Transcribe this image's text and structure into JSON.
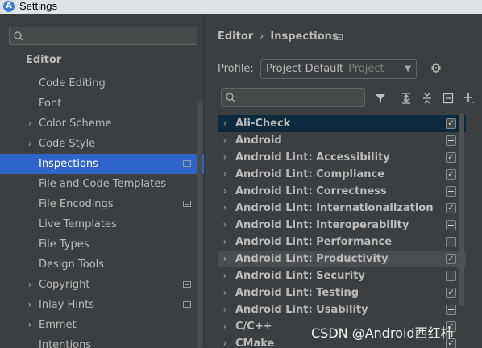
{
  "window": {
    "title": "Settings"
  },
  "left": {
    "search_placeholder": "",
    "section": "Editor",
    "items": [
      {
        "label": "Code Editing",
        "chevron": false,
        "project_icon": false
      },
      {
        "label": "Font",
        "chevron": false,
        "project_icon": false
      },
      {
        "label": "Color Scheme",
        "chevron": true,
        "project_icon": false
      },
      {
        "label": "Code Style",
        "chevron": true,
        "project_icon": false
      },
      {
        "label": "Inspections",
        "chevron": false,
        "project_icon": true,
        "selected": true
      },
      {
        "label": "File and Code Templates",
        "chevron": false,
        "project_icon": false
      },
      {
        "label": "File Encodings",
        "chevron": false,
        "project_icon": true
      },
      {
        "label": "Live Templates",
        "chevron": false,
        "project_icon": false
      },
      {
        "label": "File Types",
        "chevron": false,
        "project_icon": false
      },
      {
        "label": "Design Tools",
        "chevron": false,
        "project_icon": false
      },
      {
        "label": "Copyright",
        "chevron": true,
        "project_icon": true
      },
      {
        "label": "Inlay Hints",
        "chevron": true,
        "project_icon": true
      },
      {
        "label": "Emmet",
        "chevron": true,
        "project_icon": false
      },
      {
        "label": "Intentions",
        "chevron": false,
        "project_icon": false
      }
    ]
  },
  "breadcrumb": {
    "parent": "Editor",
    "separator": "›",
    "current": "Inspections"
  },
  "profile": {
    "label": "Profile:",
    "value": "Project Default",
    "scope": "Project"
  },
  "tree": {
    "search_placeholder": "",
    "rows": [
      {
        "label": "Ali-Check",
        "state": "checked",
        "style": "selected"
      },
      {
        "label": "Android",
        "state": "partial"
      },
      {
        "label": "Android Lint: Accessibility",
        "state": "checked"
      },
      {
        "label": "Android Lint: Compliance",
        "state": "checked"
      },
      {
        "label": "Android Lint: Correctness",
        "state": "partial"
      },
      {
        "label": "Android Lint: Internationalization",
        "state": "checked"
      },
      {
        "label": "Android Lint: Interoperability",
        "state": "partial"
      },
      {
        "label": "Android Lint: Performance",
        "state": "partial"
      },
      {
        "label": "Android Lint: Productivity",
        "state": "checked",
        "style": "hover"
      },
      {
        "label": "Android Lint: Security",
        "state": "partial"
      },
      {
        "label": "Android Lint: Testing",
        "state": "checked"
      },
      {
        "label": "Android Lint: Usability",
        "state": "partial"
      },
      {
        "label": "C/C++",
        "state": "checked"
      },
      {
        "label": "CMake",
        "state": "checked"
      }
    ]
  },
  "watermark": "CSDN @Android西红柿",
  "colors": {
    "selection": "#2f65ca",
    "tree_selection": "#0d293e",
    "background": "#3c3f41"
  }
}
